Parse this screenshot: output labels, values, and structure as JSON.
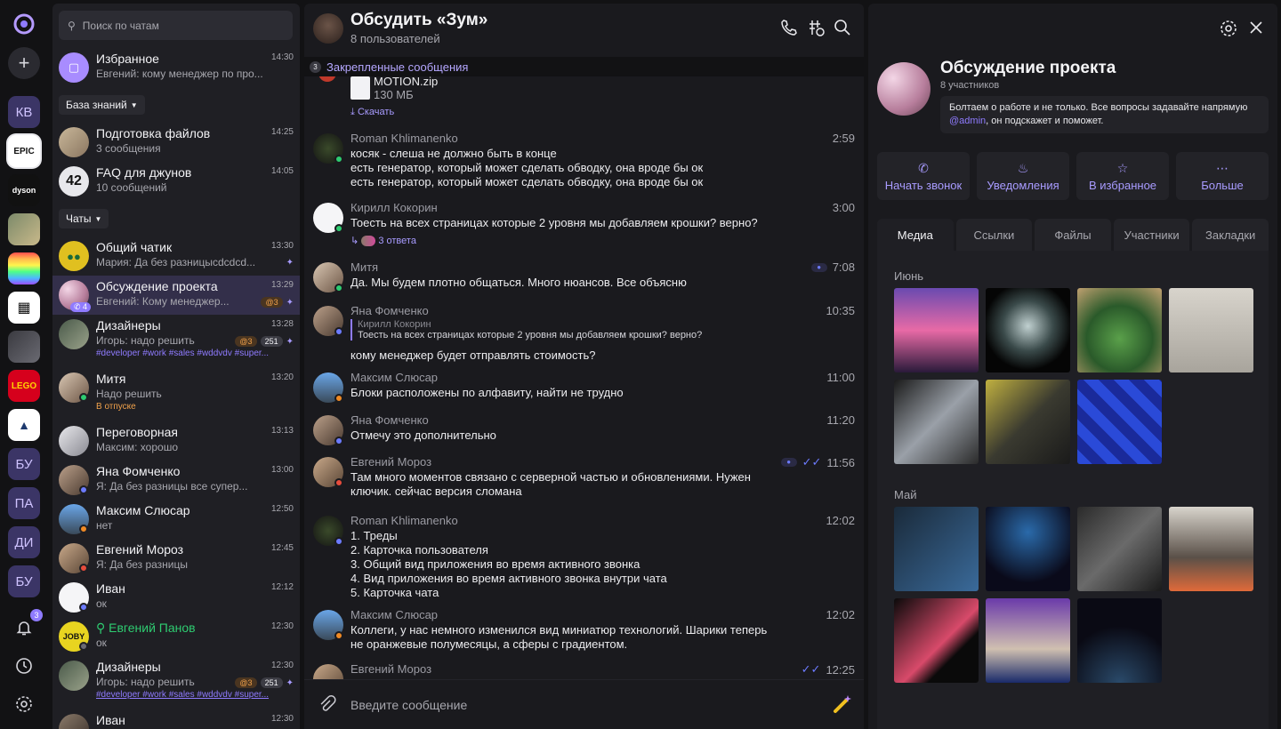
{
  "rail": {
    "items": [
      {
        "label": "КВ"
      },
      {
        "label": "БУ"
      },
      {
        "label": "ПА"
      },
      {
        "label": "ДИ"
      },
      {
        "label": "БУ"
      }
    ],
    "notifications_badge": "3"
  },
  "chatlist": {
    "search_placeholder": "Поиск по чатам",
    "section_knowledge": "База знаний",
    "section_chats": "Чаты",
    "items": [
      {
        "title": "Избранное",
        "preview": "Евгений: кому менеджер по про...",
        "time": "14:30"
      },
      {
        "title": "Подготовка файлов",
        "preview": "3 сообщения",
        "time": "14:25"
      },
      {
        "title": "FAQ для джунов",
        "preview": "10 сообщений",
        "time": "14:05"
      },
      {
        "title": "Общий чатик",
        "preview": "Мария: Да без разницыcdcdcd...",
        "time": "13:30"
      },
      {
        "title": "Обсуждение проекта",
        "preview": "Евгений: Кому менеджер...",
        "time": "13:29",
        "mentions": "@3",
        "call_badge": "4"
      },
      {
        "title": "Дизайнеры",
        "preview": "Игорь: надо решить",
        "time": "13:28",
        "mentions": "@3",
        "count": "251",
        "tags": "#developer #work #sales #wddvdv #super..."
      },
      {
        "title": "Митя",
        "preview": "Надо решить",
        "time": "13:20",
        "status_text": "В отпуске"
      },
      {
        "title": "Переговорная",
        "preview": "Максим: хорошо",
        "time": "13:13"
      },
      {
        "title": "Яна Фомченко",
        "preview": "Я: Да без разницы все супер...",
        "time": "13:00"
      },
      {
        "title": "Максим Слюсар",
        "preview": "нет",
        "time": "12:50"
      },
      {
        "title": "Евгений Мороз",
        "preview": "Я: Да без разницы",
        "time": "12:45"
      },
      {
        "title": "Иван",
        "preview": "ок",
        "time": "12:12"
      },
      {
        "title": "Евгений Панов",
        "preview": "ок",
        "time": "12:30"
      },
      {
        "title": "Дизайнеры",
        "preview": "Игорь: надо решить",
        "time": "12:30",
        "mentions": "@3",
        "count": "251",
        "tags": "#developer #work #sales #wddvdv #super..."
      },
      {
        "title": "Иван",
        "preview": "",
        "time": "12:30"
      }
    ]
  },
  "conversation": {
    "title": "Обсудить «Зум»",
    "subtitle": "8 пользователей",
    "pinned_count": "3",
    "pinned_label": "Закрепленные сообщения",
    "file": {
      "name": "MOTION.zip",
      "size": "130 МБ",
      "download": "Скачать"
    },
    "messages": [
      {
        "author": "Roman Khlimanenko",
        "time": "2:59",
        "lines": [
          "косяк - слеша не должно быть в конце",
          "есть генератор, который может сделать обводку, она вроде бы ок",
          "есть генератор, который может сделать обводку, она вроде бы ок"
        ]
      },
      {
        "author": "Кирилл Кокорин",
        "time": "3:00",
        "lines": [
          "Тоесть на всех страницах которые 2 уровня мы добавляем крошки? верно?"
        ],
        "replies": "3 ответа"
      },
      {
        "author": "Митя",
        "time": "7:08",
        "lines": [
          "Да. Мы будем плотно общаться. Много нюансов. Все объясню"
        ]
      },
      {
        "author": "Яна Фомченко",
        "time": "10:35",
        "quote_author": "Кирилл Кокорин",
        "quote_text": "Тоесть на всех страницах которые 2 уровня мы добавляем крошки? верно?",
        "lines": [
          "кому менеджер будет отправлять стоимость?"
        ]
      },
      {
        "author": "Максим Слюсар",
        "time": "11:00",
        "lines": [
          "Блоки расположены по алфавиту, найти не трудно"
        ]
      },
      {
        "author": "Яна Фомченко",
        "time": "11:20",
        "lines": [
          "Отмечу это дополнительно"
        ]
      },
      {
        "author": "Евгений Мороз",
        "time": "11:56",
        "lines": [
          "Там много моментов связано с серверной частью и обновлениями. Нужен",
          "ключик. сейчас версия сломана"
        ]
      },
      {
        "author": "Roman Khlimanenko",
        "time": "12:02",
        "lines": [
          "1. Треды",
          "2. Карточка пользователя",
          "3. Общий вид приложения во время активного звонка",
          "4. Вид приложения во время активного звонка внутри чата",
          "5. Карточка чата"
        ]
      },
      {
        "author": "Максим Слюсар",
        "time": "12:02",
        "lines": [
          "Коллеги, у нас немного изменился вид миниатюр технологий. Шарики теперь",
          "не оранжевые полумесяцы, а сферы с градиентом."
        ]
      },
      {
        "author": "Евгений Мороз",
        "time": "12:25",
        "lines": []
      }
    ],
    "composer_placeholder": "Введите сообщение"
  },
  "panel": {
    "title": "Обсуждение проекта",
    "subtitle": "8 участников",
    "description_before": "Болтаем о работе и не только. Все вопросы задавайте напрямую ",
    "description_mention": "@admin",
    "description_after": ", он подскажет и поможет.",
    "actions": [
      {
        "label": "Начать звонок",
        "icon": "phone-icon"
      },
      {
        "label": "Уведомления",
        "icon": "bell-icon"
      },
      {
        "label": "В избранное",
        "icon": "star-icon"
      },
      {
        "label": "Больше",
        "icon": "more-icon"
      }
    ],
    "tabs": [
      {
        "label": "Медиа"
      },
      {
        "label": "Ссылки"
      },
      {
        "label": "Файлы"
      },
      {
        "label": "Участники"
      },
      {
        "label": "Закладки"
      }
    ],
    "months": [
      {
        "label": "Июнь"
      },
      {
        "label": "Май"
      }
    ]
  },
  "colors": {
    "accent": "#8f7bff",
    "online": "#2ecc71",
    "away": "#f08a24",
    "dnd": "#e74c3c",
    "offline": "#6c7bff"
  }
}
